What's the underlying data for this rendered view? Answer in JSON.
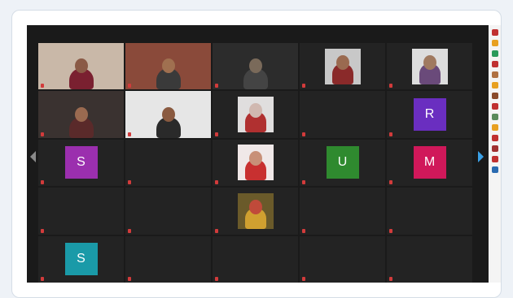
{
  "meeting": {
    "tiles": [
      {
        "type": "video",
        "active": true,
        "label": "",
        "bg": "#c9b8a8",
        "skin": "#8a5a46",
        "shirt": "#7a2030"
      },
      {
        "type": "video",
        "label": "",
        "bg": "#8a4a3a",
        "skin": "#a07050",
        "shirt": "#3a3a3a"
      },
      {
        "type": "video",
        "label": "",
        "bg": "#2c2c2c",
        "skin": "#7a6a5a",
        "shirt": "#444"
      },
      {
        "type": "photo",
        "label": "",
        "bg": "#c8c8c8",
        "skin": "#9a6a50",
        "shirt": "#8a2a2a"
      },
      {
        "type": "photo",
        "label": "",
        "bg": "#dddddd",
        "skin": "#a07a60",
        "shirt": "#6a4a7a"
      },
      {
        "type": "video",
        "label": "",
        "bg": "#3a3230",
        "skin": "#9a6a50",
        "shirt": "#5a2a2a"
      },
      {
        "type": "video",
        "label": "",
        "bg": "#e6e6e6",
        "skin": "#8a5a40",
        "shirt": "#2a2a2a"
      },
      {
        "type": "photo",
        "label": "",
        "bg": "#e0dede",
        "skin": "#d0b8b0",
        "shirt": "#b03030"
      },
      {
        "type": "name",
        "name": "",
        "label": ""
      },
      {
        "type": "avatar",
        "letter": "R",
        "color": "#6a2ec0",
        "label": ""
      },
      {
        "type": "avatar",
        "letter": "S",
        "color": "#9b2fae",
        "label": ""
      },
      {
        "type": "name",
        "name": "",
        "label": ""
      },
      {
        "type": "photo",
        "label": "",
        "bg": "#f0e8e8",
        "skin": "#c89078",
        "shirt": "#c83030"
      },
      {
        "type": "avatar",
        "letter": "U",
        "color": "#2f8a2f",
        "label": ""
      },
      {
        "type": "avatar",
        "letter": "M",
        "color": "#d0185a",
        "label": ""
      },
      {
        "type": "name",
        "name": "",
        "label": ""
      },
      {
        "type": "name",
        "name": "",
        "label": ""
      },
      {
        "type": "photo",
        "label": "",
        "bg": "#6a5a2a",
        "skin": "#c04a3a",
        "shirt": "#d0a030"
      },
      {
        "type": "name",
        "name": "",
        "label": ""
      },
      {
        "type": "name",
        "name": "",
        "label": ""
      },
      {
        "type": "avatar",
        "letter": "S",
        "color": "#1a9aa8",
        "label": ""
      },
      {
        "type": "name",
        "name": "",
        "label": ""
      },
      {
        "type": "name",
        "name": "",
        "label": ""
      },
      {
        "type": "name",
        "name": "",
        "label": ""
      },
      {
        "type": "name",
        "name": "",
        "label": ""
      }
    ],
    "accent_active": "#e8d832",
    "nav_next_color": "#3aa0e6"
  },
  "sidebar": {
    "dots": [
      "#c03030",
      "#e8a020",
      "#2a9a5a",
      "#c03030",
      "#b07040",
      "#e8a020",
      "#8a4a2a",
      "#c03030",
      "#5a8a5a",
      "#e8a020",
      "#c03030",
      "#a03030",
      "#c03030",
      "#2a6ab0"
    ]
  }
}
